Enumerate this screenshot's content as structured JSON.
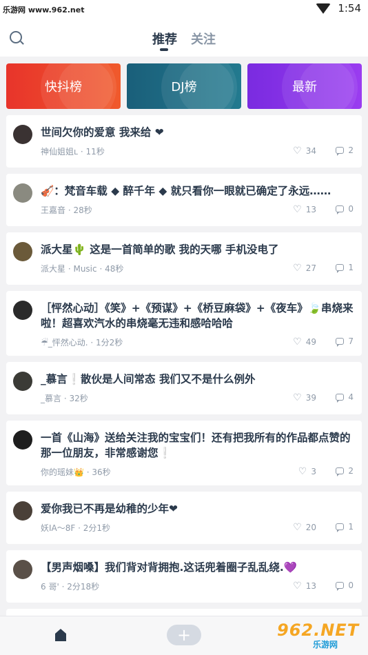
{
  "status_bar": {
    "site": "乐游网 www.962.net",
    "time": "1:54"
  },
  "header": {
    "tabs": [
      "推荐",
      "关注"
    ]
  },
  "banners": [
    {
      "label": "快抖榜",
      "color": "#ef3b2d"
    },
    {
      "label": "DJ榜",
      "color": "#1f6f86"
    },
    {
      "label": "最新",
      "color": "#8a2be2"
    }
  ],
  "feed": [
    {
      "title": "世间欠你的爱意  我来给 ❤",
      "author": "神仙姐姐ʟ",
      "time": "11秒",
      "likes": "34",
      "comments": "2"
    },
    {
      "title": "🎻：梵音车载 ◆ 醉千年 ◆ 就只看你一眼就已确定了永远……",
      "author": "王嘉音",
      "time": "28秒",
      "likes": "13",
      "comments": "0"
    },
    {
      "title": "派大星🌵   这是一首简单的歌     我的天哪     手机没电了",
      "author": "派大星",
      "music": "Music",
      "time": "48秒",
      "likes": "27",
      "comments": "1"
    },
    {
      "title": "［怦然心动］《笑》+《预谋》+《桥豆麻袋》+《夜车》🍃串烧来啦！超喜欢汽水的串烧毫无违和感哈哈哈",
      "author": "☔_怦然心动.",
      "time": "1分2秒",
      "likes": "49",
      "comments": "7"
    },
    {
      "title": "_慕言❕散伙是人间常态 我们又不是什么例外",
      "author": "_慕言",
      "time": "32秒",
      "likes": "39",
      "comments": "4"
    },
    {
      "title": "一首《山海》送给关注我的宝宝们！还有把我所有的作品都点赞的那一位朋友，非常感谢您❕",
      "author": "你的瑶妹👑",
      "time": "36秒",
      "likes": "3",
      "comments": "2"
    },
    {
      "title": "爱你我已不再是幼稚的少年❤",
      "author": "妖IA～8F",
      "time": "2分1秒",
      "likes": "20",
      "comments": "1"
    },
    {
      "title": "【男声烟嗓】我们背对背拥抱.这话兜着圈子乱乱绕.💜",
      "author": "6 哥'",
      "time": "2分18秒",
      "likes": "13",
      "comments": "0"
    }
  ],
  "bottom_bar": {
    "plus": "+"
  },
  "watermark": {
    "big": "962.NET",
    "small": "乐游网"
  }
}
